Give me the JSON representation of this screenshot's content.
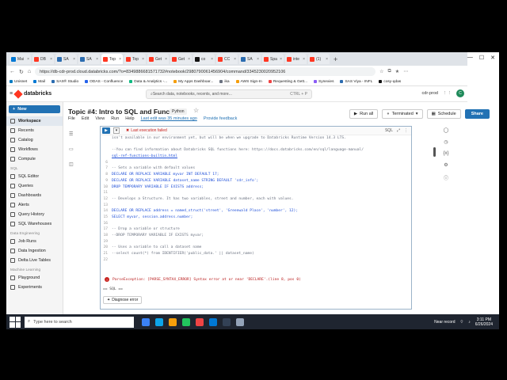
{
  "browser": {
    "tabs": [
      {
        "label": "Mai",
        "color": "#0078d4",
        "active": false
      },
      {
        "label": "DB",
        "color": "#ff3621",
        "active": false
      },
      {
        "label": "SA",
        "color": "#2b6cb0",
        "active": false
      },
      {
        "label": "SA",
        "color": "#2b6cb0",
        "active": false
      },
      {
        "label": "Top",
        "color": "#ff3621",
        "active": true
      },
      {
        "label": "Top",
        "color": "#ff3621",
        "active": false
      },
      {
        "label": "Get",
        "color": "#ff3621",
        "active": false
      },
      {
        "label": "Get",
        "color": "#ff3621",
        "active": false
      },
      {
        "label": "co",
        "color": "#111111",
        "active": false
      },
      {
        "label": "CC",
        "color": "#ff3621",
        "active": false
      },
      {
        "label": "SA",
        "color": "#2b6cb0",
        "active": false
      },
      {
        "label": "Spa",
        "color": "#ff3621",
        "active": false
      },
      {
        "label": "inte",
        "color": "#ff3621",
        "active": false
      },
      {
        "label": "(1)",
        "color": "#ff3621",
        "active": false
      }
    ],
    "url": "https://db-cdr-prod.cloud.databricks.com/?o=8349886681571732#notebook/2980790061456904/command/3345230020952106",
    "bookmarks": [
      {
        "label": "Unisnet",
        "color": "#0a7cc2"
      },
      {
        "label": "Mail",
        "color": "#0078d4"
      },
      {
        "label": "SAS® Studio",
        "color": "#2b6cb0"
      },
      {
        "label": "ODAS - Confluence",
        "color": "#2563eb"
      },
      {
        "label": "Data & Analytics -...",
        "color": "#10b981"
      },
      {
        "label": "My Apps Dashboar...",
        "color": "#f59e0b"
      },
      {
        "label": "ika",
        "color": "#6b7280"
      },
      {
        "label": "AWS Sign-In",
        "color": "#f59e0b"
      },
      {
        "label": "Requesting & Gett...",
        "color": "#ef4444"
      },
      {
        "label": "Synexies",
        "color": "#8b5cf6"
      },
      {
        "label": "SAS Viya - INFL",
        "color": "#2b6cb0"
      },
      {
        "label": "cosy-qdas",
        "color": "#111111"
      }
    ]
  },
  "header": {
    "logo": "databricks",
    "search_placeholder": "Search data, notebooks, recents, and more...",
    "search_shortcut": "CTRL + P",
    "workspace": "cdr-prod",
    "avatar_letter": "C"
  },
  "sidebar": {
    "new_label": "New",
    "items": [
      {
        "label": "Workspace",
        "active": true
      },
      {
        "label": "Recents",
        "active": false
      },
      {
        "label": "Catalog",
        "active": false
      },
      {
        "label": "Workflows",
        "active": false
      },
      {
        "label": "Compute",
        "active": false
      }
    ],
    "section_sql": "SQL",
    "sql_items": [
      "SQL Editor",
      "Queries",
      "Dashboards",
      "Alerts",
      "Query History",
      "SQL Warehouses"
    ],
    "section_data": "Data Engineering",
    "data_items": [
      "Job Runs",
      "Data Ingestion",
      "Delta Live Tables"
    ],
    "section_ml": "Machine Learning",
    "ml_items": [
      "Playground",
      "Experiments"
    ]
  },
  "notebook": {
    "title": "Topic #4: Intro to SQL and Functions",
    "language": "Python",
    "menu": [
      "File",
      "Edit",
      "View",
      "Run",
      "Help"
    ],
    "last_edit": "Last edit was 35 minutes ago",
    "feedback": "Provide feedback",
    "run_all": "Run all",
    "cluster": "Terminated",
    "schedule": "Schedule",
    "share": "Share"
  },
  "cell": {
    "status": "Last execution failed",
    "lang_tag": "SQL",
    "lines": [
      {
        "n": "",
        "text": "isn't available in our environment yet, but will be when we upgrade to Databricks Runtime Version 14.3 LTS.",
        "cls": "cm"
      },
      {
        "n": "",
        "text": "",
        "cls": "src"
      },
      {
        "n": "",
        "text": "--You can find information about Databricks SQL functions here: https://docs.databricks.com/en/sql/language-manual/",
        "cls": "cm"
      },
      {
        "n": "",
        "text": "sql-ref-functions-builtin.html",
        "cls": "lnk"
      },
      {
        "n": "6",
        "text": "",
        "cls": "src"
      },
      {
        "n": "7",
        "text": "-- Sets a variable with default values",
        "cls": "cm"
      },
      {
        "n": "8",
        "text": "DECLARE OR REPLACE VARIABLE myvar INT DEFAULT 17;",
        "cls": "kw"
      },
      {
        "n": "9",
        "text": "DECLARE OR REPLACE VARIABLE dataset_name STRING DEFAULT 'cdr_info';",
        "cls": "kw"
      },
      {
        "n": "10",
        "text": "DROP TEMPORARY VARIABLE IF EXISTS address;",
        "cls": "kw"
      },
      {
        "n": "11",
        "text": "",
        "cls": "src"
      },
      {
        "n": "12",
        "text": "-- Develops a Structure. It has two variables, street and number, each with values.",
        "cls": "cm"
      },
      {
        "n": "13",
        "text": "",
        "cls": "src"
      },
      {
        "n": "14",
        "text": "DECLARE OR REPLACE address = named_struct('street', 'Greenwald Place', 'number', 12);",
        "cls": "kw"
      },
      {
        "n": "15",
        "text": "SELECT myvar, session.address.number;",
        "cls": "kw"
      },
      {
        "n": "16",
        "text": "",
        "cls": "src"
      },
      {
        "n": "17",
        "text": "-- Drop a variable or structure",
        "cls": "cm"
      },
      {
        "n": "18",
        "text": "--DROP TEMPORARY VARIABLE IF EXISTS myvar;",
        "cls": "cm"
      },
      {
        "n": "19",
        "text": "",
        "cls": "src"
      },
      {
        "n": "20",
        "text": "-- Uses a variable to call a dataset name",
        "cls": "cm"
      },
      {
        "n": "21",
        "text": "--select count(*) from IDENTIFIER('public_data.' || dataset_name)",
        "cls": "cm"
      },
      {
        "n": "22",
        "text": "",
        "cls": "src"
      }
    ],
    "error": "ParseException: [PARSE_SYNTAX_ERROR] Syntax error at or near 'DECLARE'.(line 8, pos 0)",
    "sql_more": "== SQL ==",
    "diagnose": "Diagnose error"
  },
  "taskbar": {
    "search_placeholder": "Type here to search",
    "weather": "Near record",
    "time": "3:11 PM",
    "date": "6/26/2024",
    "apps": [
      "#3b82f6",
      "#0ea5e9",
      "#f59e0b",
      "#22c55e",
      "#ef4444",
      "#0078d4",
      "#334155",
      "#94a3b8"
    ]
  }
}
